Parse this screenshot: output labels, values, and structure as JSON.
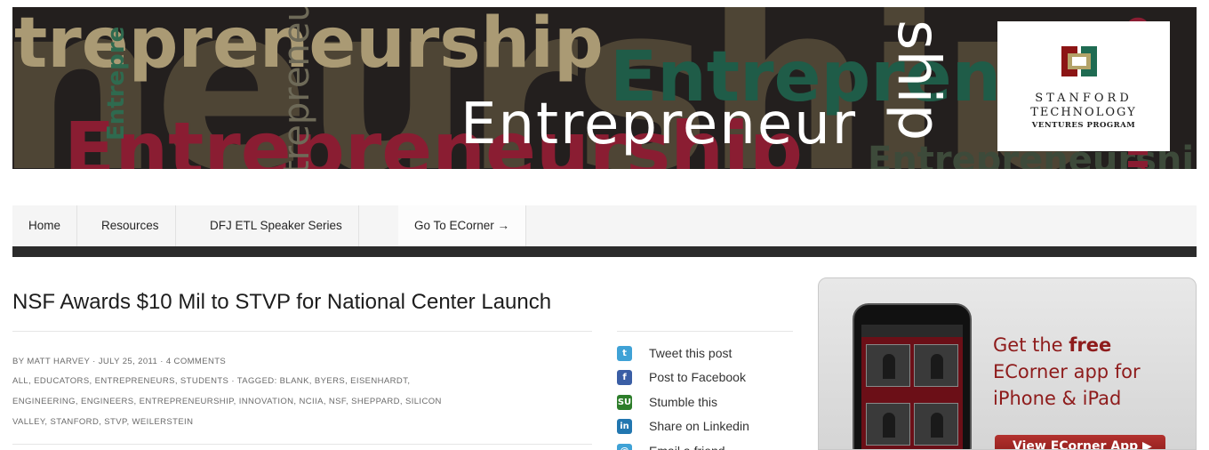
{
  "banner": {
    "top_word": "trepreneurship",
    "huge_word": "neurship",
    "green_word": "Entrepren",
    "red_word": "Entrepreneurship",
    "low_word": "Entrepreneurship",
    "vertical_word_1": "Entrepre",
    "vertical_word_2": "trepreneu",
    "right_word": "dreneurship",
    "main_word": "Entrepreneur",
    "ship_word": "ship",
    "logo": {
      "line1": "STANFORD",
      "line2": "TECHNOLOGY",
      "line3": "VENTURES PROGRAM",
      "mark_colors": [
        "#8c1515",
        "#1f6b52",
        "#b3a369"
      ]
    }
  },
  "nav": {
    "items": [
      "Home",
      "Resources",
      "DFJ ETL Speaker Series",
      "Go To ECorner →"
    ]
  },
  "post": {
    "title": "NSF Awards $10 Mil to STVP for National Center Launch",
    "meta_line_1": "BY MATT HARVEY · JULY 25, 2011 · 4 COMMENTS",
    "meta_line_2": "ALL, EDUCATORS, ENTREPRENEURS, STUDENTS · TAGGED: BLANK, BYERS, EISENHARDT,",
    "meta_line_3": "ENGINEERING, ENGINEERS, ENTREPRENEURSHIP, INNOVATION, NCIIA, NSF, SHEPPARD, SILICON",
    "meta_line_4": "VALLEY, STANFORD, STVP, WEILERSTEIN"
  },
  "share": {
    "items": [
      {
        "label": "Tweet this post",
        "icon": "twitter-icon",
        "glyph": "t"
      },
      {
        "label": "Post to Facebook",
        "icon": "facebook-icon",
        "glyph": "f"
      },
      {
        "label": "Stumble this",
        "icon": "stumbleupon-icon",
        "glyph": "SU"
      },
      {
        "label": "Share on Linkedin",
        "icon": "linkedin-icon",
        "glyph": "in"
      },
      {
        "label": "Email a friend",
        "icon": "email-icon",
        "glyph": "@"
      }
    ]
  },
  "promo": {
    "line1_prefix": "Get the ",
    "line1_bold": "free",
    "line2": "ECorner app for",
    "line3": "iPhone & iPad",
    "button_label": "View ECorner App ▶",
    "accent": "#8e1b1b"
  }
}
